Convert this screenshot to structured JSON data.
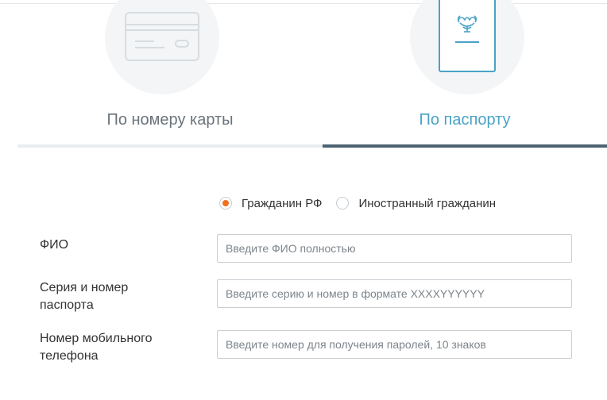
{
  "tabs": {
    "card": {
      "label": "По номеру карты",
      "icon": "credit-card-icon"
    },
    "passport": {
      "label": "По паспорту",
      "icon": "passport-icon"
    },
    "active": "passport"
  },
  "citizenship": {
    "options": [
      {
        "label": "Гражданин РФ",
        "checked": true
      },
      {
        "label": "Иностранный гражданин",
        "checked": false
      }
    ]
  },
  "form": {
    "fio": {
      "label": "ФИО",
      "placeholder": "Введите ФИО полностью"
    },
    "passport": {
      "label_line1": "Серия и номер",
      "label_line2": "паспорта",
      "placeholder": "Введите серию и номер в формате XXXXYYYYYY"
    },
    "phone": {
      "label_line1": "Номер мобильного",
      "label_line2": "телефона",
      "placeholder": "Введите номер для получения паролей, 10 знаков"
    }
  },
  "colors": {
    "accent": "#4aa3c6",
    "active_underline": "#4d6372",
    "radio_checked": "#f26f21"
  }
}
